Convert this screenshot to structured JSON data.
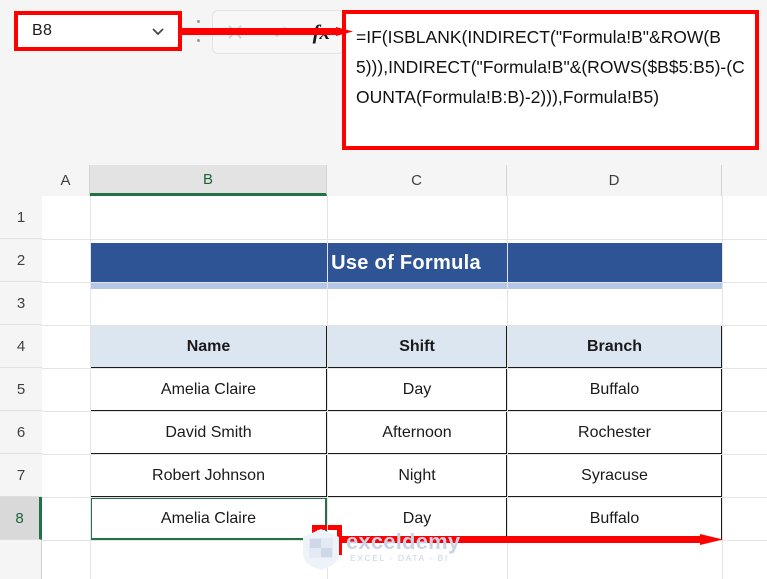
{
  "namebox": {
    "value": "B8",
    "placeholder": "Name Box",
    "chevron_icon": "chevron-down-icon"
  },
  "formula_bar": {
    "cancel_icon": "cancel-x-icon",
    "enter_icon": "enter-check-icon",
    "function_icon": "fx-insert-function-icon",
    "formula": "=IF(ISBLANK(INDIRECT(\"Formula!B\"&ROW(B5))),INDIRECT(\"Formula!B\"&(ROWS($B$5:B5)-(COUNTA(Formula!B:B)-2))),Formula!B5)"
  },
  "grid": {
    "columns": [
      "A",
      "B",
      "C",
      "D"
    ],
    "selected_column": "B",
    "rows": [
      "1",
      "2",
      "3",
      "4",
      "5",
      "6",
      "7",
      "8"
    ],
    "selected_row": "8",
    "selected_cell": "B8"
  },
  "banner": {
    "title": "Use of Formula"
  },
  "table": {
    "headers": [
      "Name",
      "Shift",
      "Branch"
    ],
    "rows": [
      [
        "Amelia Claire",
        "Day",
        "Buffalo"
      ],
      [
        "David Smith",
        "Afternoon",
        "Rochester"
      ],
      [
        "Robert Johnson",
        "Night",
        "Syracuse"
      ],
      [
        "Amelia Claire",
        "Day",
        "Buffalo"
      ]
    ]
  },
  "annotations": {
    "arrow_color": "#ff0000",
    "highlight_color": "#ff0000",
    "fill_handle_label": "fill-handle"
  },
  "watermark": {
    "brand": "exceldemy",
    "tagline": "EXCEL - DATA - BI"
  },
  "colors": {
    "banner_bg": "#2e5496",
    "banner_strip": "#b4c7e7",
    "header_bg": "#dce6f1",
    "selection_green": "#217346"
  }
}
